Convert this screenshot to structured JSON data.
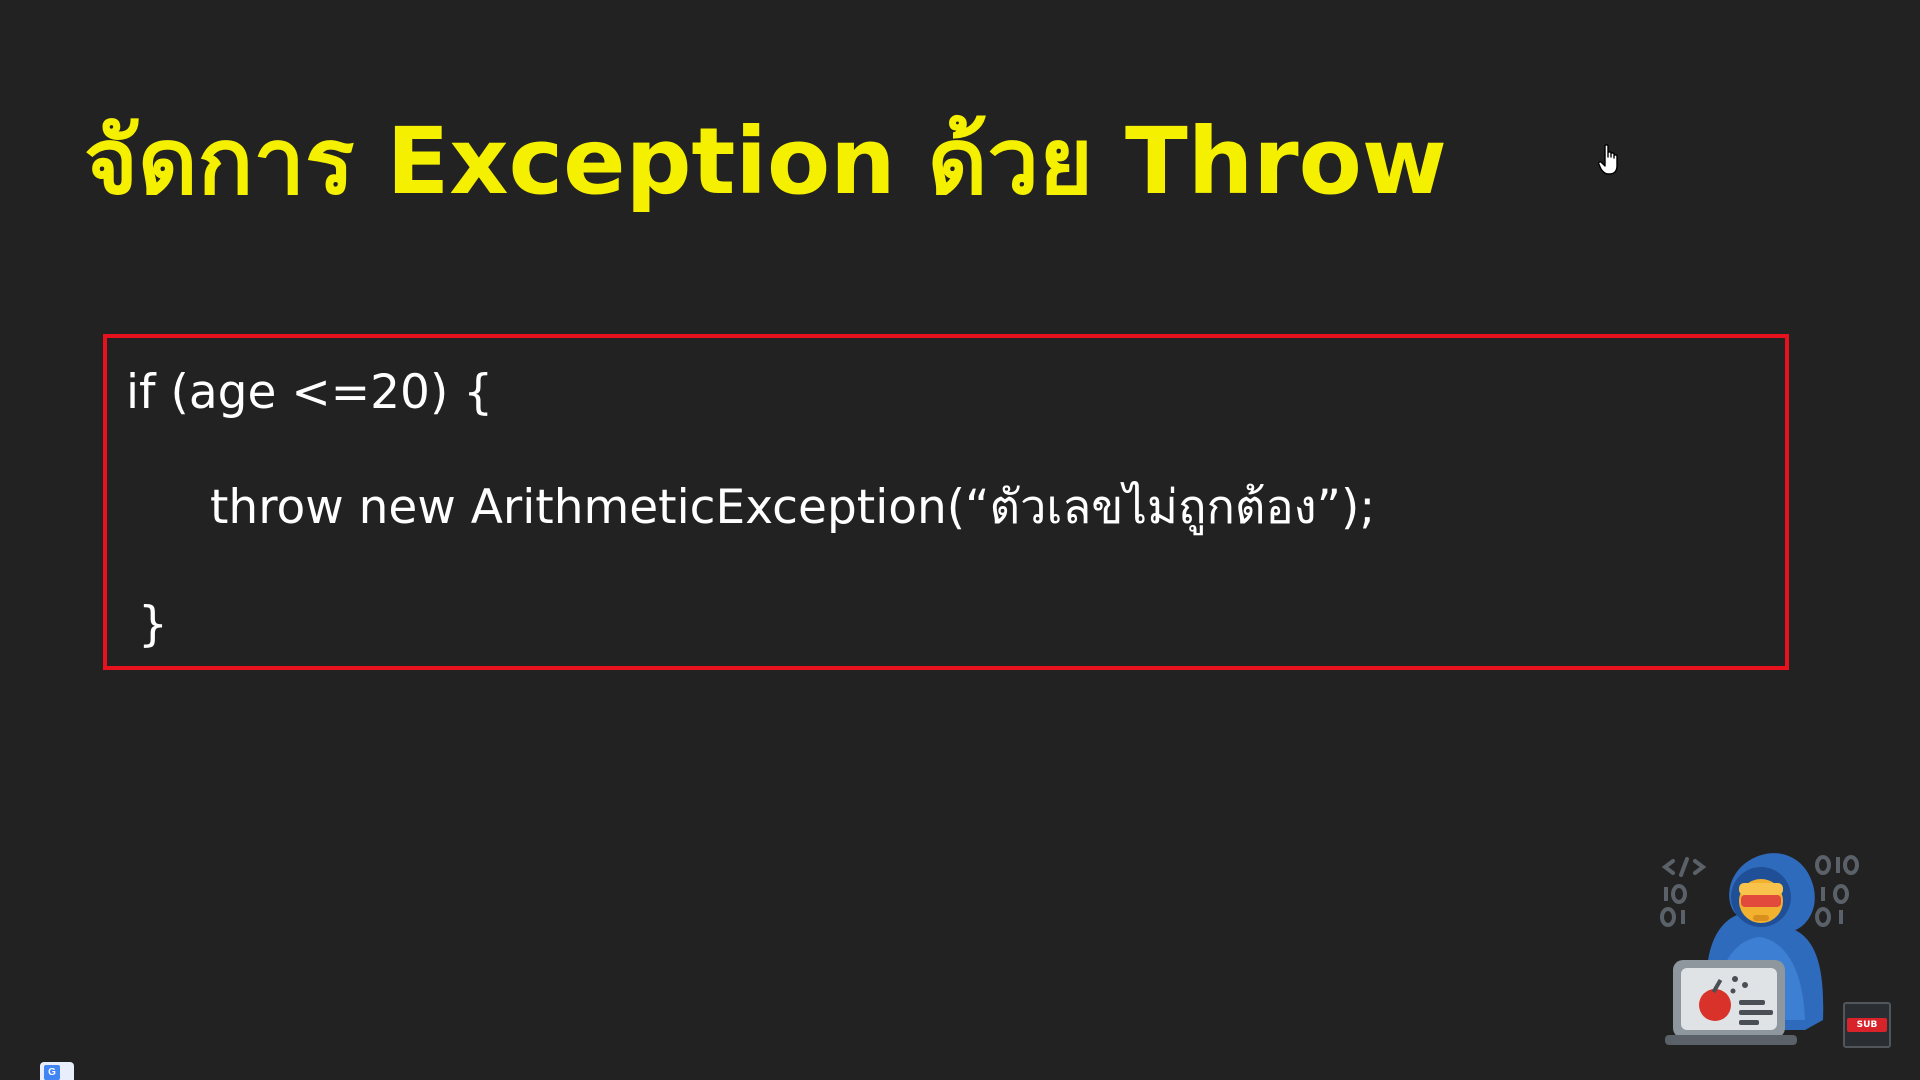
{
  "slide": {
    "title": "จัดการ Exception ด้วย Throw"
  },
  "code": {
    "lines": [
      "if (age <=20) {",
      "throw new ArithmeticException(“ตัวเลขไม่ถูกต้อง”);",
      "}"
    ]
  },
  "overlay": {
    "cursor_icon": "hand-pointer-icon",
    "channel_logo_icon": "coder-mascot-icon",
    "subscribe_badge_text": "SUB",
    "subscribe_icon": "subscribe-icon",
    "translate_icon": "google-translate-icon",
    "translate_glyph": "G"
  },
  "colors": {
    "background": "#222222",
    "title": "#f5f000",
    "code_text": "#ffffff",
    "code_border": "#e8121f"
  }
}
